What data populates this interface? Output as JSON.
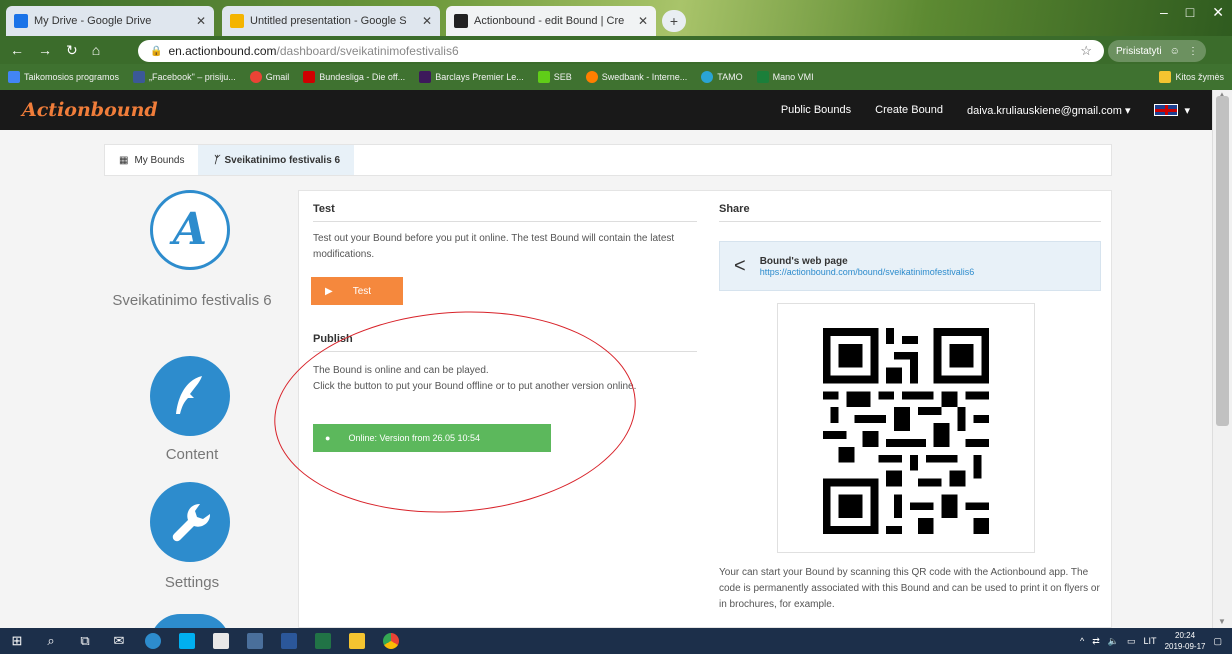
{
  "browser": {
    "tabs": [
      {
        "title": "My Drive - Google Drive",
        "color": "#1a73e8"
      },
      {
        "title": "Untitled presentation - Google S",
        "color": "#f4b400"
      },
      {
        "title": "Actionbound - edit Bound | Cre",
        "color": "#222222"
      }
    ],
    "url_host": "en.actionbound.com",
    "url_path": "/dashboard/sveikatinimofestivalis6",
    "profile_label": "Prisistatyti",
    "bookmarks": [
      {
        "label": "Taikomosios programos",
        "color": "#4285f4"
      },
      {
        "label": "„Facebook\" – prisiju...",
        "color": "#3b5998"
      },
      {
        "label": "Gmail",
        "color": "#ea4335"
      },
      {
        "label": "Bundesliga - Die off...",
        "color": "#d00000"
      },
      {
        "label": "Barclays Premier Le...",
        "color": "#3d195b"
      },
      {
        "label": "SEB",
        "color": "#60cd18"
      },
      {
        "label": "Swedbank - Interne...",
        "color": "#ff7f00"
      },
      {
        "label": "TAMO",
        "color": "#2aa4d5"
      },
      {
        "label": "Mano VMI",
        "color": "#1b7f3a"
      }
    ],
    "bookmark_other": "Kitos žymės"
  },
  "site": {
    "logo": "Actionbound",
    "nav": [
      "Public Bounds",
      "Create Bound"
    ],
    "user_email": "daiva.kruliauskiene@gmail.com"
  },
  "breadcrumb": {
    "home": "My Bounds",
    "current": "Sveikatinimo festivalis 6"
  },
  "sidebar": {
    "bound_name": "Sveikatinimo festivalis 6",
    "items": [
      {
        "label": "Content",
        "icon": "quill-icon"
      },
      {
        "label": "Settings",
        "icon": "wrench-icon"
      }
    ]
  },
  "test": {
    "title": "Test",
    "text": "Test out your Bound before you put it online. The test Bound will contain the latest modifications.",
    "button": "Test"
  },
  "publish": {
    "title": "Publish",
    "line1": "The Bound is online and can be played.",
    "line2": "Click the button to put your Bound offline or to put another version online.",
    "button": "Online: Version from 26.05 10:54"
  },
  "share": {
    "title": "Share",
    "webpage_title": "Bound's web page",
    "webpage_link": "https://actionbound.com/bound/sveikatinimofestivalis6",
    "qr_text": "Your can start your Bound by scanning this QR code with the Actionbound app. The code is permanently associated with this Bound and can be used to print it on flyers or in brochures, for example."
  },
  "taskbar": {
    "lang": "LIT",
    "time": "20:24",
    "date": "2019-09-17"
  },
  "colors": {
    "accent_blue": "#2d8ccd",
    "orange": "#f5883d",
    "green": "#5cb85c",
    "annotation_red": "#d8232a"
  }
}
